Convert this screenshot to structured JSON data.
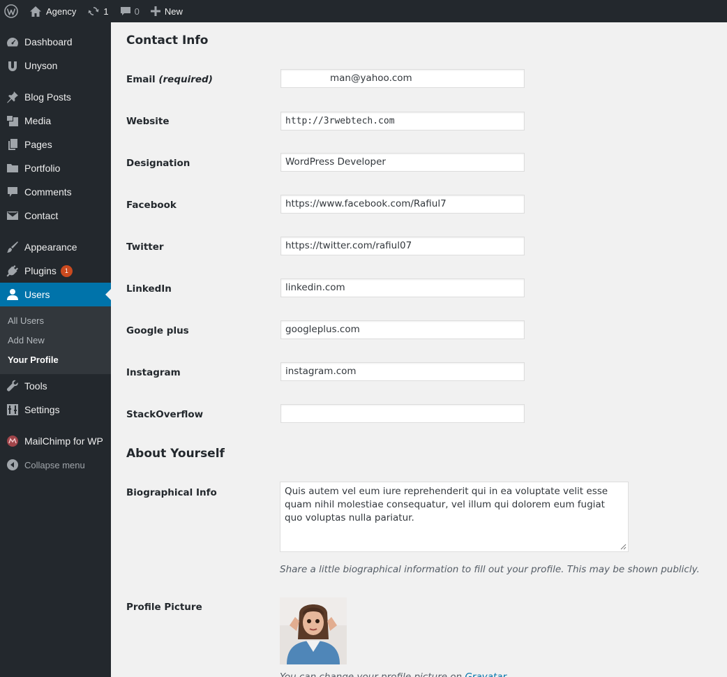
{
  "admin_bar": {
    "site_name": "Agency",
    "updates_count": "1",
    "comments_count": "0",
    "new_label": "New"
  },
  "sidebar": {
    "items": [
      {
        "label": "Dashboard",
        "icon": "dashboard-icon"
      },
      {
        "label": "Unyson",
        "icon": "unyson-icon"
      },
      {
        "label": "Blog Posts",
        "icon": "pin-icon"
      },
      {
        "label": "Media",
        "icon": "media-icon"
      },
      {
        "label": "Pages",
        "icon": "pages-icon"
      },
      {
        "label": "Portfolio",
        "icon": "folder-icon"
      },
      {
        "label": "Comments",
        "icon": "comment-icon"
      },
      {
        "label": "Contact",
        "icon": "envelope-icon"
      },
      {
        "label": "Appearance",
        "icon": "brush-icon"
      },
      {
        "label": "Plugins",
        "icon": "plug-icon",
        "badge": "1"
      },
      {
        "label": "Users",
        "icon": "user-icon"
      },
      {
        "label": "Tools",
        "icon": "wrench-icon"
      },
      {
        "label": "Settings",
        "icon": "settings-icon"
      },
      {
        "label": "MailChimp for WP",
        "icon": "mailchimp-icon"
      },
      {
        "label": "Collapse menu",
        "icon": "collapse-icon"
      }
    ],
    "users_submenu": [
      "All Users",
      "Add New",
      "Your Profile"
    ],
    "current": "Users",
    "current_sub": "Your Profile"
  },
  "contact_info": {
    "heading": "Contact Info",
    "email_label": "Email",
    "email_required": "(required)",
    "email_value": "man@yahoo.com",
    "website_label": "Website",
    "website_value": "http://3rwebtech.com",
    "designation_label": "Designation",
    "designation_value": "WordPress Developer",
    "facebook_label": "Facebook",
    "facebook_value": "https://www.facebook.com/Rafiul7",
    "twitter_label": "Twitter",
    "twitter_value": "https://twitter.com/rafiul07",
    "linkedin_label": "LinkedIn",
    "linkedin_value": "linkedin.com",
    "googleplus_label": "Google plus",
    "googleplus_value": "googleplus.com",
    "instagram_label": "Instagram",
    "instagram_value": "instagram.com",
    "stackoverflow_label": "StackOverflow",
    "stackoverflow_value": ""
  },
  "about": {
    "heading": "About Yourself",
    "bio_label": "Biographical Info",
    "bio_value": "Quis autem vel eum iure reprehenderit qui in ea voluptate velit esse quam nihil molestiae consequatur, vel illum qui dolorem eum fugiat quo voluptas nulla pariatur.",
    "bio_description": "Share a little biographical information to fill out your profile. This may be shown publicly.",
    "picture_label": "Profile Picture",
    "picture_note_prefix": "You can change your profile picture on",
    "picture_note_link": "Gravatar"
  },
  "colors": {
    "admin_bg": "#23282d",
    "accent": "#0073aa",
    "badge": "#ca4a1f",
    "content_bg": "#f1f1f1"
  }
}
